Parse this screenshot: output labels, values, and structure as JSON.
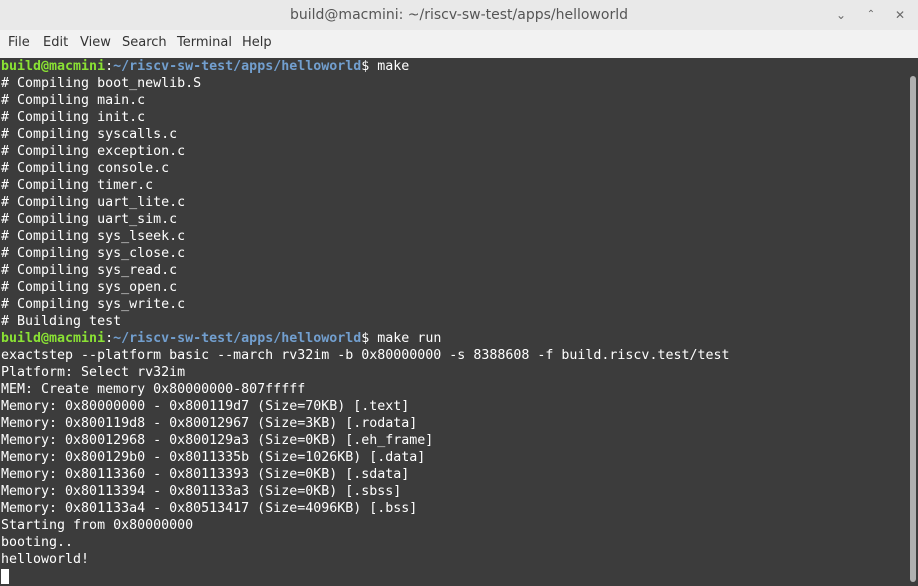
{
  "window": {
    "title": "build@macmini: ~/riscv-sw-test/apps/helloworld",
    "controls": {
      "minimize": "⌄",
      "maximize": "⌃",
      "close": "✕"
    }
  },
  "menu": [
    "File",
    "Edit",
    "View",
    "Search",
    "Terminal",
    "Help"
  ],
  "prompt": {
    "user_host": "build@macmini",
    "separator": ":",
    "path": "~/riscv-sw-test/apps/helloworld",
    "symbol": "$"
  },
  "commands": {
    "make": " make",
    "make_run": " make run"
  },
  "make_output": [
    "# Compiling boot_newlib.S",
    "# Compiling main.c",
    "# Compiling init.c",
    "# Compiling syscalls.c",
    "# Compiling exception.c",
    "# Compiling console.c",
    "# Compiling timer.c",
    "# Compiling uart_lite.c",
    "# Compiling uart_sim.c",
    "# Compiling sys_lseek.c",
    "# Compiling sys_close.c",
    "# Compiling sys_read.c",
    "# Compiling sys_open.c",
    "# Compiling sys_write.c",
    "# Building test"
  ],
  "run_output": [
    "exactstep --platform basic --march rv32im -b 0x80000000 -s 8388608 -f build.riscv.test/test",
    "Platform: Select rv32im",
    "MEM: Create memory 0x80000000-807fffff",
    "Memory: 0x80000000 - 0x800119d7 (Size=70KB) [.text]",
    "Memory: 0x800119d8 - 0x80012967 (Size=3KB) [.rodata]",
    "Memory: 0x80012968 - 0x800129a3 (Size=0KB) [.eh_frame]",
    "Memory: 0x800129b0 - 0x8011335b (Size=1026KB) [.data]",
    "Memory: 0x80113360 - 0x80113393 (Size=0KB) [.sdata]",
    "Memory: 0x80113394 - 0x801133a3 (Size=0KB) [.sbss]",
    "Memory: 0x801133a4 - 0x80513417 (Size=4096KB) [.bss]",
    "Starting from 0x80000000",
    "booting..",
    "helloworld!"
  ],
  "colors": {
    "terminal_bg": "#3c3c3c",
    "prompt_user": "#8ae234",
    "prompt_path": "#729fcf",
    "text": "#ffffff"
  }
}
